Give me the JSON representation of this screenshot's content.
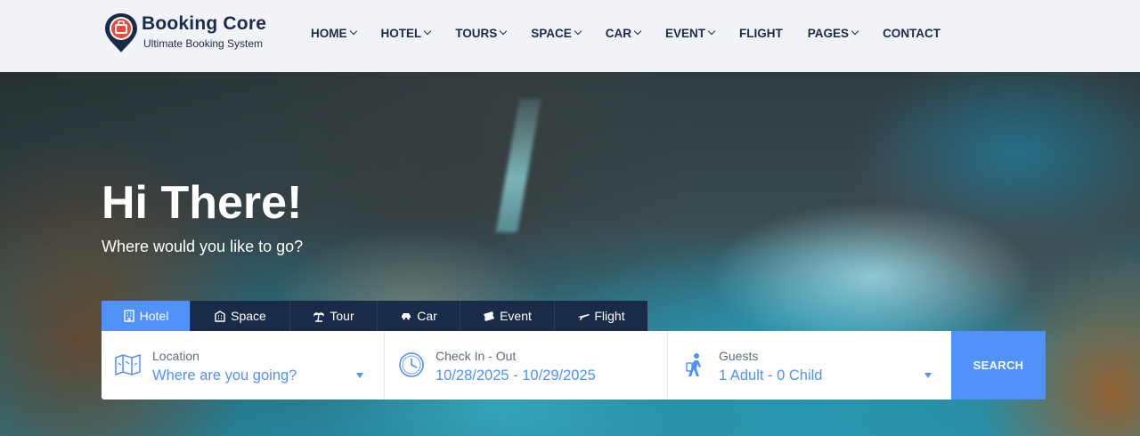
{
  "brand": {
    "title": "Booking Core",
    "subtitle": "Ultimate Booking System",
    "accent": "#5191fa",
    "logo_red": "#e74c3c",
    "navy": "#1a2b48"
  },
  "nav": {
    "items": [
      {
        "label": "HOME",
        "has_dropdown": true
      },
      {
        "label": "HOTEL",
        "has_dropdown": true
      },
      {
        "label": "TOURS",
        "has_dropdown": true
      },
      {
        "label": "SPACE",
        "has_dropdown": true
      },
      {
        "label": "CAR",
        "has_dropdown": true
      },
      {
        "label": "EVENT",
        "has_dropdown": true
      },
      {
        "label": "FLIGHT",
        "has_dropdown": false
      },
      {
        "label": "PAGES",
        "has_dropdown": true
      },
      {
        "label": "CONTACT",
        "has_dropdown": false
      }
    ]
  },
  "hero": {
    "title": "Hi There!",
    "subtitle": "Where would you like to go?"
  },
  "tabs": [
    {
      "label": "Hotel",
      "icon": "hotel-icon",
      "active": true
    },
    {
      "label": "Space",
      "icon": "building-icon",
      "active": false
    },
    {
      "label": "Tour",
      "icon": "palm-tree-icon",
      "active": false
    },
    {
      "label": "Car",
      "icon": "car-icon",
      "active": false
    },
    {
      "label": "Event",
      "icon": "ticket-icon",
      "active": false
    },
    {
      "label": "Flight",
      "icon": "plane-icon",
      "active": false
    }
  ],
  "search": {
    "location": {
      "label": "Location",
      "value": "Where are you going?",
      "icon": "map-icon"
    },
    "dates": {
      "label": "Check In - Out",
      "value": "10/28/2025 - 10/29/2025",
      "icon": "clock-icon"
    },
    "guests": {
      "label": "Guests",
      "value": "1 Adult - 0 Child",
      "icon": "traveler-icon"
    },
    "button_label": "SEARCH"
  }
}
